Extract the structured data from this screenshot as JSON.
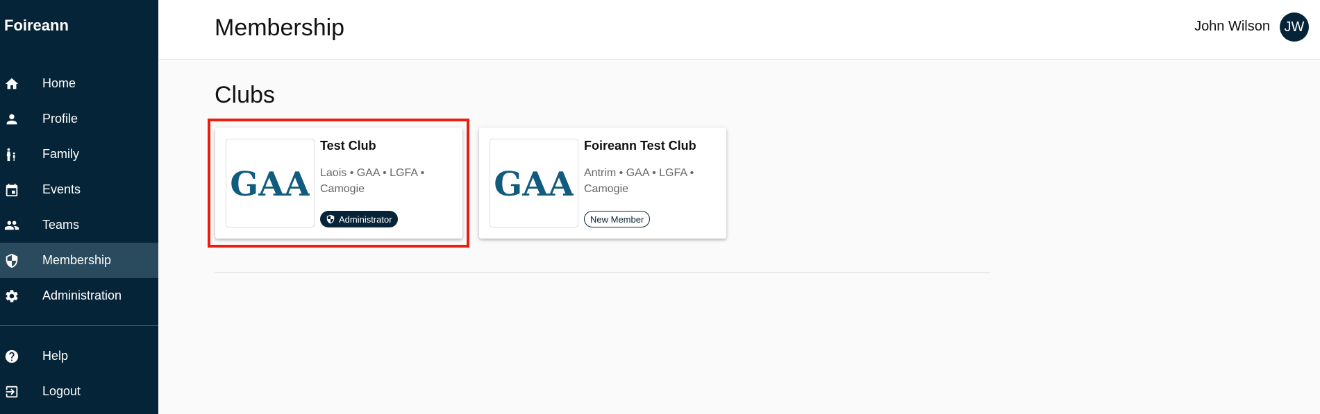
{
  "app": {
    "brand": "Foireann"
  },
  "sidebar": {
    "items": [
      {
        "label": "Home",
        "icon": "home-icon"
      },
      {
        "label": "Profile",
        "icon": "person-icon"
      },
      {
        "label": "Family",
        "icon": "family-icon"
      },
      {
        "label": "Events",
        "icon": "calendar-icon"
      },
      {
        "label": "Teams",
        "icon": "group-icon"
      },
      {
        "label": "Membership",
        "icon": "shield-icon",
        "active": true
      },
      {
        "label": "Administration",
        "icon": "gear-icon"
      }
    ],
    "secondary": [
      {
        "label": "Help",
        "icon": "help-icon"
      },
      {
        "label": "Logout",
        "icon": "logout-icon"
      }
    ]
  },
  "header": {
    "title": "Membership",
    "user_name": "John Wilson",
    "user_initials": "JW"
  },
  "main": {
    "section_title": "Clubs",
    "clubs": [
      {
        "name": "Test Club",
        "tags": "Laois • GAA • LGFA • Camogie",
        "role": "Administrator",
        "logo_text": "GAA"
      },
      {
        "name": "Foireann Test Club",
        "tags": "Antrim • GAA • LGFA • Camogie",
        "role": "New Member",
        "logo_text": "GAA"
      }
    ]
  },
  "colors": {
    "sidebar_bg": "#062438",
    "active_bg": "#2a4a5e",
    "logo_blue": "#115c7e",
    "highlight": "#ee1c0c"
  }
}
